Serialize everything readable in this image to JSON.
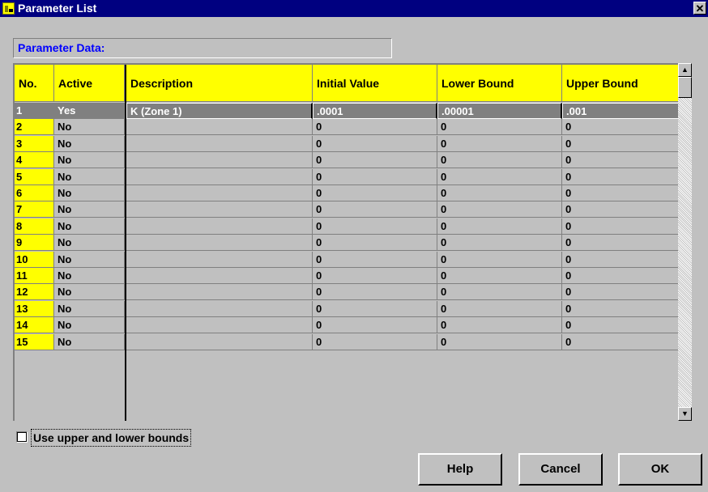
{
  "window": {
    "title": "Parameter List",
    "close_glyph": "✕"
  },
  "section_label": "Parameter Data:",
  "columns": [
    "No.",
    "Active",
    "Description",
    "Initial Value",
    "Lower Bound",
    "Upper Bound"
  ],
  "rows": [
    {
      "no": "1",
      "active": "Yes",
      "description": "K (Zone 1)",
      "initial": ".0001",
      "lower": ".00001",
      "upper": ".001"
    },
    {
      "no": "2",
      "active": "No",
      "description": "",
      "initial": "0",
      "lower": "0",
      "upper": "0"
    },
    {
      "no": "3",
      "active": "No",
      "description": "",
      "initial": "0",
      "lower": "0",
      "upper": "0"
    },
    {
      "no": "4",
      "active": "No",
      "description": "",
      "initial": "0",
      "lower": "0",
      "upper": "0"
    },
    {
      "no": "5",
      "active": "No",
      "description": "",
      "initial": "0",
      "lower": "0",
      "upper": "0"
    },
    {
      "no": "6",
      "active": "No",
      "description": "",
      "initial": "0",
      "lower": "0",
      "upper": "0"
    },
    {
      "no": "7",
      "active": "No",
      "description": "",
      "initial": "0",
      "lower": "0",
      "upper": "0"
    },
    {
      "no": "8",
      "active": "No",
      "description": "",
      "initial": "0",
      "lower": "0",
      "upper": "0"
    },
    {
      "no": "9",
      "active": "No",
      "description": "",
      "initial": "0",
      "lower": "0",
      "upper": "0"
    },
    {
      "no": "10",
      "active": "No",
      "description": "",
      "initial": "0",
      "lower": "0",
      "upper": "0"
    },
    {
      "no": "11",
      "active": "No",
      "description": "",
      "initial": "0",
      "lower": "0",
      "upper": "0"
    },
    {
      "no": "12",
      "active": "No",
      "description": "",
      "initial": "0",
      "lower": "0",
      "upper": "0"
    },
    {
      "no": "13",
      "active": "No",
      "description": "",
      "initial": "0",
      "lower": "0",
      "upper": "0"
    },
    {
      "no": "14",
      "active": "No",
      "description": "",
      "initial": "0",
      "lower": "0",
      "upper": "0"
    },
    {
      "no": "15",
      "active": "No",
      "description": "",
      "initial": "0",
      "lower": "0",
      "upper": "0"
    }
  ],
  "checkbox": {
    "label": "Use upper and lower bounds",
    "checked": false
  },
  "buttons": {
    "help": "Help",
    "cancel": "Cancel",
    "ok": "OK"
  },
  "scrollbar": {
    "up_glyph": "▲",
    "down_glyph": "▼"
  },
  "colors": {
    "title_bar": "#000080",
    "header_bg": "#ffff00",
    "selected_row": "#808080",
    "section_label": "#0000ff"
  }
}
